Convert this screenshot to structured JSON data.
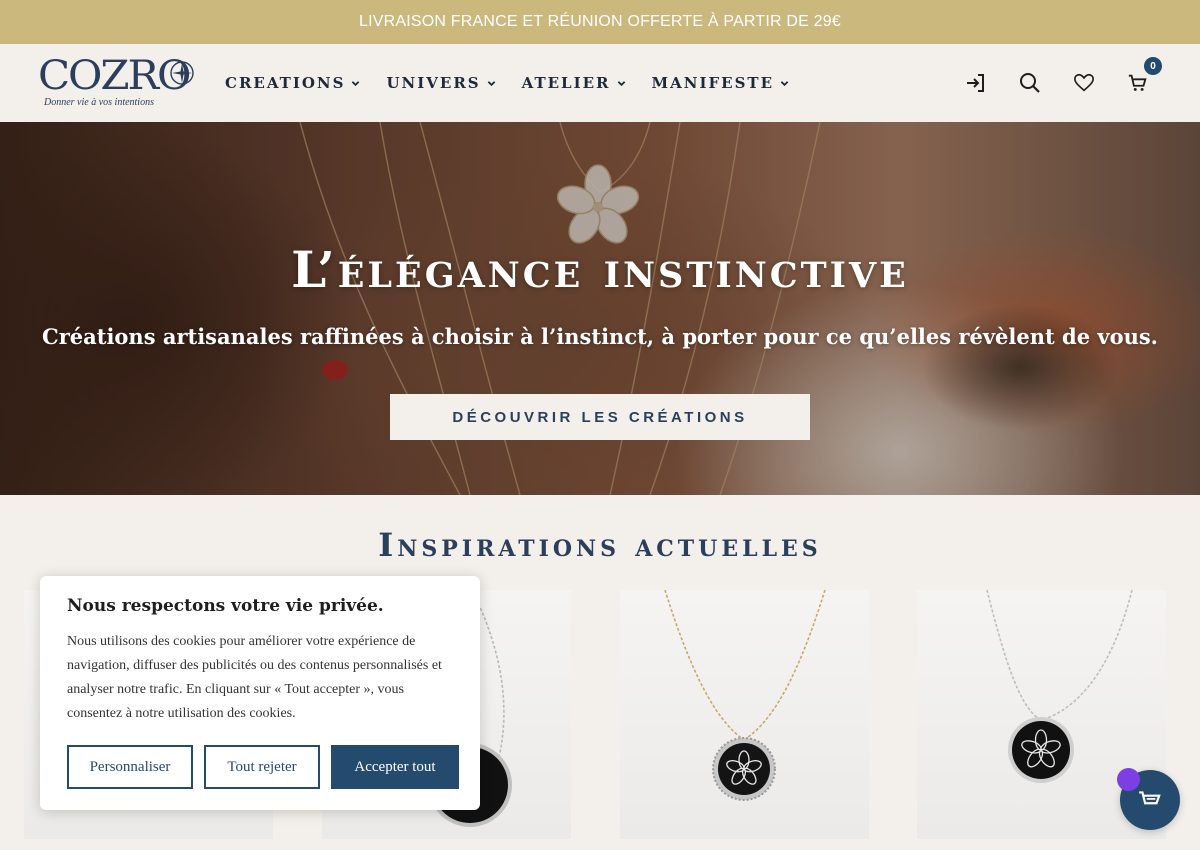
{
  "promo": {
    "text": "LIVRAISON FRANCE ET RÉUNION OFFERTE À PARTIR DE 29€"
  },
  "brand": {
    "name": "COZRO",
    "tagline": "Donner vie à vos intentions"
  },
  "nav": {
    "items": [
      {
        "label": "CREATIONS",
        "icon": "chevron-down-icon"
      },
      {
        "label": "UNIVERS",
        "icon": "chevron-down-icon"
      },
      {
        "label": "ATELIER",
        "icon": "chevron-down-icon"
      },
      {
        "label": "MANIFESTE",
        "icon": "chevron-down-icon"
      }
    ]
  },
  "header_icons": {
    "login": "login-icon",
    "search": "search-icon",
    "wishlist": "heart-icon",
    "cart": "cart-icon",
    "cart_count": "0"
  },
  "hero": {
    "title": "L’élégance instinctive",
    "subtitle": "Créations artisanales raffinées à choisir à l’instinct, à porter pour ce qu’elles révèlent de vous.",
    "cta": "DÉCOUVRIR LES CRÉATIONS"
  },
  "section": {
    "title": "Inspirations actuelles"
  },
  "products": [
    {
      "name": "product-card-1",
      "chain": "silver"
    },
    {
      "name": "product-card-2",
      "chain": "silver"
    },
    {
      "name": "product-card-3",
      "chain": "gold"
    },
    {
      "name": "product-card-4",
      "chain": "silver"
    }
  ],
  "cookie_banner": {
    "title": "Nous respectons votre vie privée.",
    "text": "Nous utilisons des cookies pour améliorer votre expérience de navigation, diffuser des publicités ou des contenus personnalisés et analyser notre trafic. En cliquant sur « Tout accepter », vous consentez à notre utilisation des cookies.",
    "buttons": {
      "customize": "Personnaliser",
      "reject": "Tout rejeter",
      "accept": "Accepter tout"
    }
  },
  "colors": {
    "accent": "#244a6e",
    "promo": "#cbb87c",
    "background": "#f3efea",
    "floating_dot": "#7b3fe4"
  }
}
